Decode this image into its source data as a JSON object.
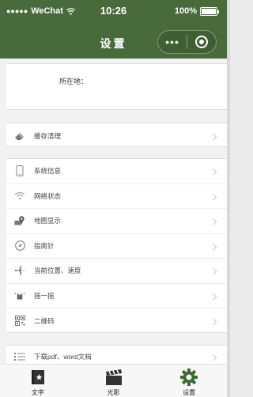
{
  "status_bar": {
    "signal": "●●●●●",
    "carrier": "WeChat",
    "time": "10:26",
    "battery": "100%",
    "battery_level": 1.0
  },
  "nav": {
    "title": "设置",
    "more": "•••"
  },
  "location": {
    "label": "所在地："
  },
  "cache": {
    "label": "缓存清理",
    "icon": "eraser-icon"
  },
  "menu": [
    {
      "label": "系统信息",
      "icon": "phone-icon"
    },
    {
      "label": "网络状态",
      "icon": "wifi-icon"
    },
    {
      "label": "地图显示",
      "icon": "map-icon"
    },
    {
      "label": "指南针",
      "icon": "compass-icon"
    },
    {
      "label": "当前位置、速度",
      "icon": "plane-icon"
    },
    {
      "label": "摇一摇",
      "icon": "shake-icon"
    },
    {
      "label": "二维码",
      "icon": "qrcode-icon"
    }
  ],
  "download": {
    "label": "下载pdf、word文档",
    "icon": "list-icon"
  },
  "tabs": [
    {
      "label": "文字",
      "icon": "book-icon"
    },
    {
      "label": "光影",
      "icon": "clapper-icon"
    },
    {
      "label": "设置",
      "icon": "gear-icon"
    }
  ],
  "colors": {
    "nav_bg": "#496b3c",
    "gear": "#3f6a36"
  }
}
